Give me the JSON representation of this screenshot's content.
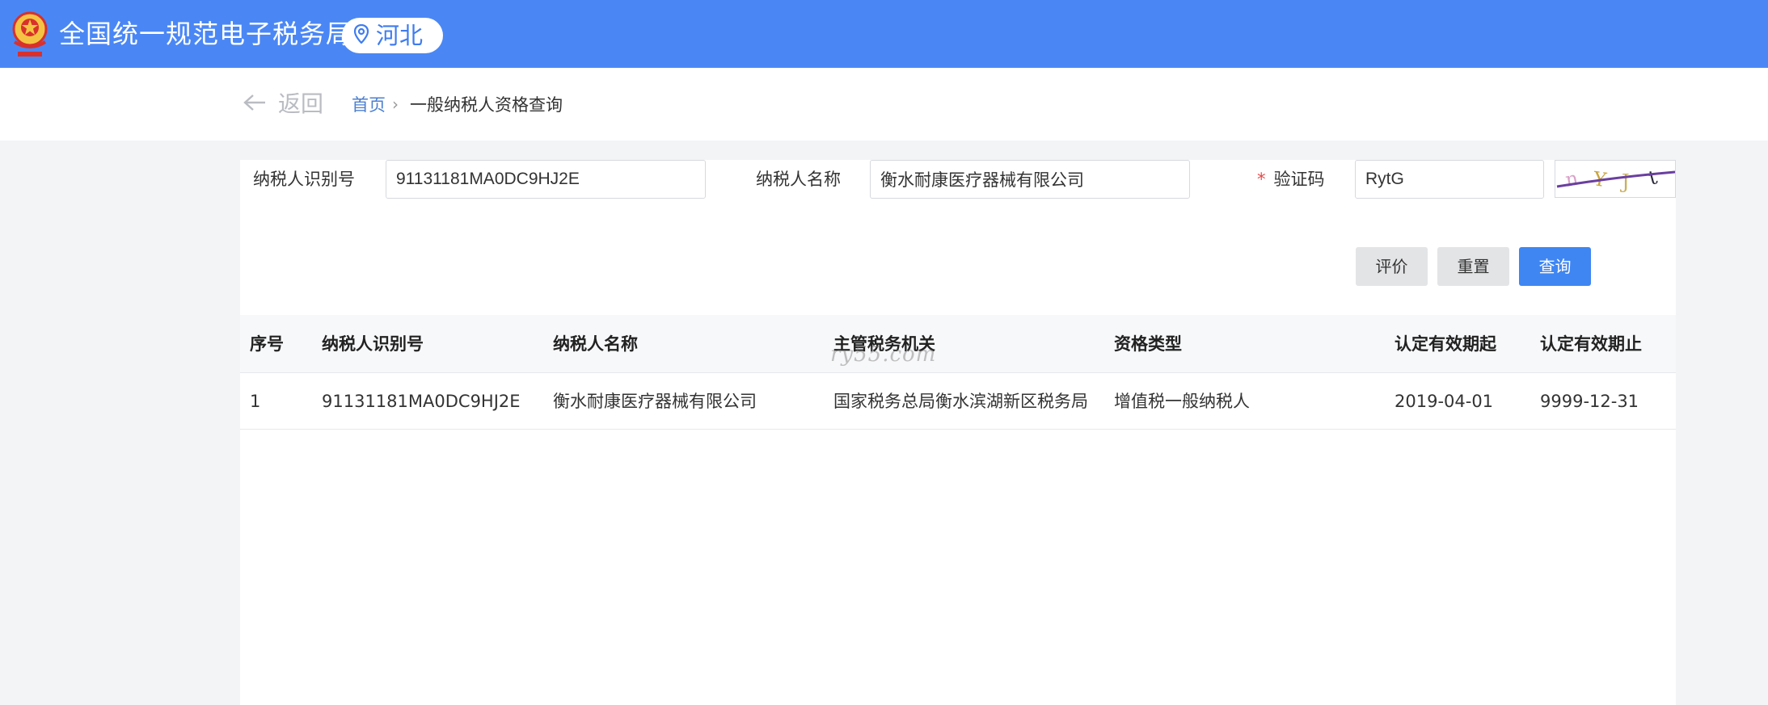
{
  "header": {
    "title": "全国统一规范电子税务局",
    "region": "河北",
    "emblem_icon": "tax-emblem-icon",
    "region_icon": "location-pin-icon",
    "brand_color": "#4a87f5"
  },
  "breadcrumb": {
    "back_label": "返回",
    "home": "首页",
    "separator": "›",
    "current": "一般纳税人资格查询"
  },
  "form": {
    "taxpayer_id_label": "纳税人识别号",
    "taxpayer_id_value": "91131181MA0DC9HJ2E",
    "taxpayer_name_label": "纳税人名称",
    "taxpayer_name_value": "衡水耐康医疗器械有限公司",
    "captcha_required_mark": "*",
    "captcha_label": "验证码",
    "captcha_value": "RytG"
  },
  "buttons": {
    "evaluate": "评价",
    "reset": "重置",
    "query": "查询"
  },
  "table": {
    "columns": [
      "序号",
      "纳税人识别号",
      "纳税人名称",
      "主管税务机关",
      "资格类型",
      "认定有效期起",
      "认定有效期止"
    ],
    "rows": [
      [
        "1",
        "91131181MA0DC9HJ2E",
        "衡水耐康医疗器械有限公司",
        "国家税务总局衡水滨湖新区税务局",
        "增值税一般纳税人",
        "2019-04-01",
        "9999-12-31"
      ]
    ]
  },
  "watermark": "ry55.com"
}
